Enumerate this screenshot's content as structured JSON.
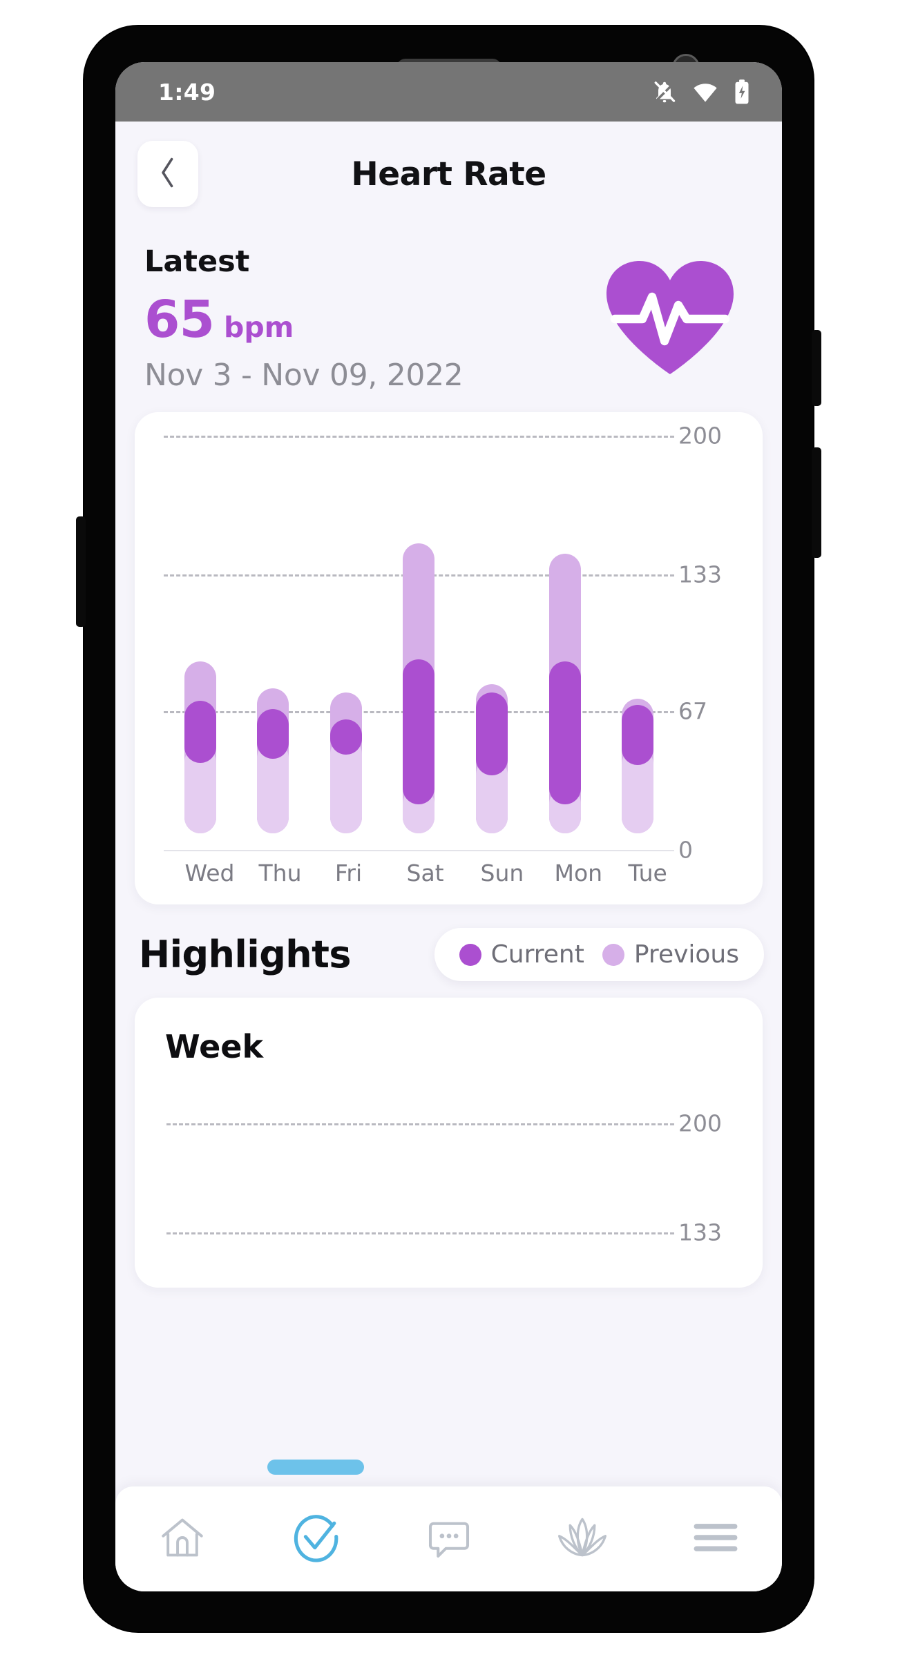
{
  "status_bar": {
    "time": "1:49",
    "icons": [
      "notifications-off-icon",
      "wifi-icon",
      "battery-charging-icon"
    ]
  },
  "header": {
    "back_icon": "chevron-left-icon",
    "title": "Heart Rate"
  },
  "latest": {
    "label": "Latest",
    "value": "65",
    "unit": "bpm",
    "date_range": "Nov 3 - Nov 09, 2022",
    "icon": "heart-pulse-icon",
    "accent_color": "#AB4FD0"
  },
  "highlights": {
    "title": "Highlights",
    "legend": [
      {
        "label": "Current",
        "color": "#AB4FD0"
      },
      {
        "label": "Previous",
        "color": "#D6AFE8"
      }
    ]
  },
  "week_card": {
    "title": "Week",
    "y_ticks": [
      "200",
      "133"
    ]
  },
  "bottom_nav": {
    "items": [
      {
        "icon": "home-icon",
        "active": false
      },
      {
        "icon": "check-circle-icon",
        "active": true
      },
      {
        "icon": "chat-bubble-icon",
        "active": false
      },
      {
        "icon": "lotus-icon",
        "active": false
      },
      {
        "icon": "menu-icon",
        "active": false
      }
    ],
    "active_color": "#4FB3E0",
    "inactive_color": "#b9bfc9"
  },
  "chart_data": {
    "type": "bar",
    "title": "Heart Rate",
    "xlabel": "",
    "ylabel": "bpm",
    "ylim": [
      0,
      200
    ],
    "yticks": [
      0,
      67,
      133,
      200
    ],
    "ytick_labels": [
      "0",
      "67",
      "133",
      "200"
    ],
    "grid": true,
    "legend_position": "top-right",
    "categories": [
      "Wed",
      "Thu",
      "Fri",
      "Sat",
      "Sun",
      "Mon",
      "Tue"
    ],
    "series": [
      {
        "name": "Previous",
        "color": "#D6AFE8",
        "type": "range",
        "low": [
          8,
          8,
          8,
          8,
          8,
          8,
          8
        ],
        "high": [
          91,
          78,
          76,
          148,
          80,
          143,
          73
        ]
      },
      {
        "name": "Current",
        "color": "#AB4FD0",
        "type": "range",
        "low": [
          42,
          44,
          46,
          22,
          36,
          22,
          41
        ],
        "high": [
          72,
          68,
          63,
          92,
          76,
          91,
          70
        ]
      }
    ]
  }
}
